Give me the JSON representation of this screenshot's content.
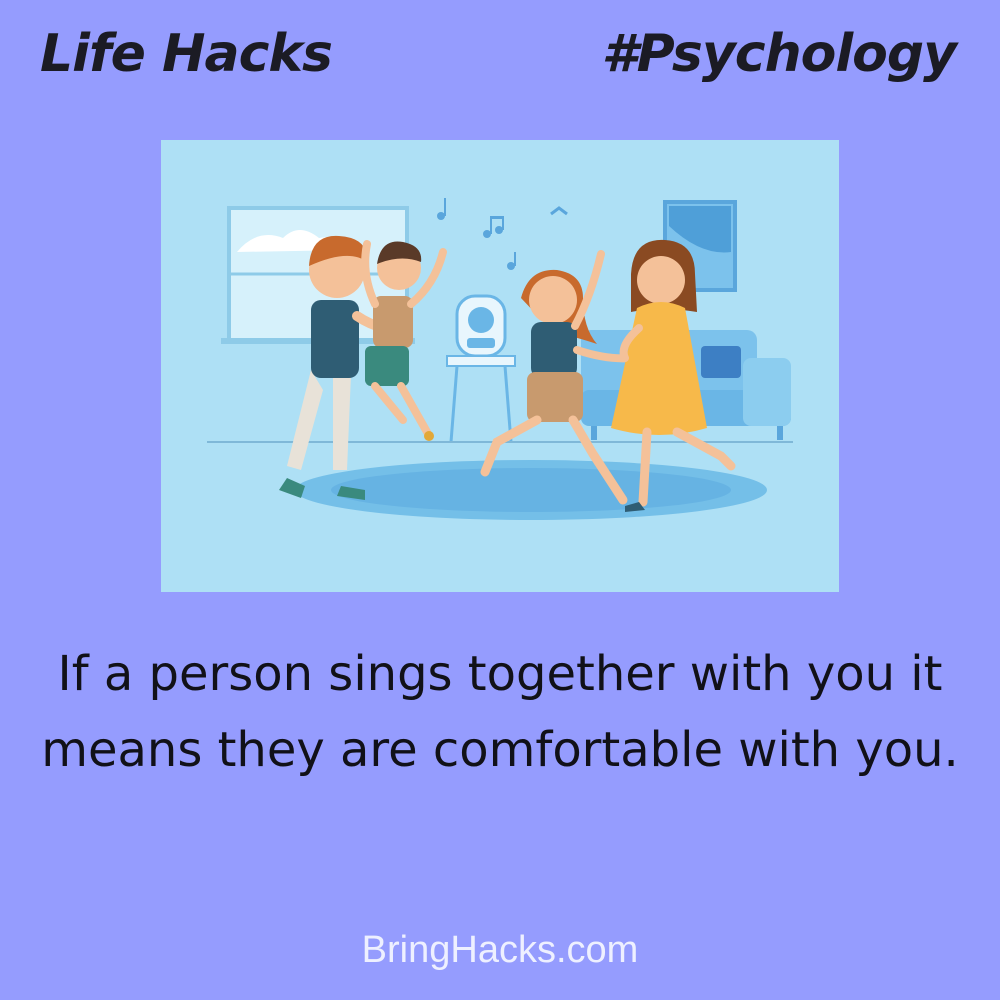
{
  "header": {
    "left_title": "Life Hacks",
    "right_tag": "#Psychology"
  },
  "illustration": {
    "icon": "family-dancing-illustration"
  },
  "caption": {
    "text": "If a person sings together with you it means they are comfortable with you."
  },
  "footer": {
    "site": "BringHacks.com"
  },
  "colors": {
    "background": "#959cfe",
    "text": "#111118",
    "footer_text": "#eef0ff",
    "illustration_bg": "#aee0f5"
  }
}
